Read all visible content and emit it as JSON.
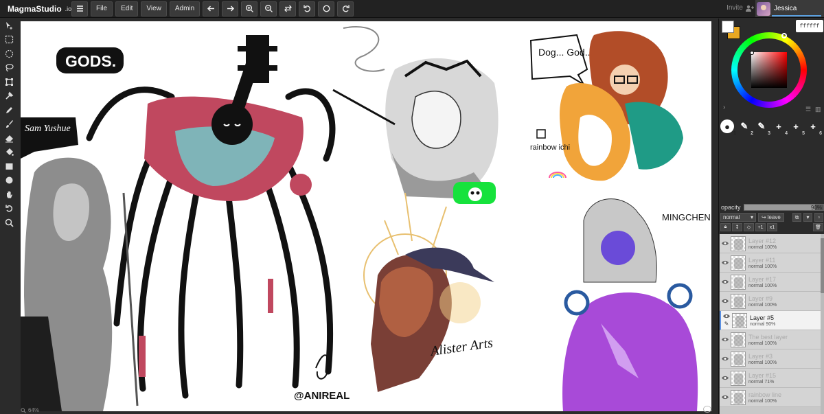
{
  "app": {
    "logo_text": "MagmaStudio",
    "logo_suffix": ".io"
  },
  "menu": {
    "file": "File",
    "edit": "Edit",
    "view": "View",
    "admin": "Admin"
  },
  "toolbar_icons": [
    "hamburger-menu-icon",
    "undo-arrow-icon",
    "redo-arrow-icon",
    "zoom-in-icon",
    "zoom-out-icon",
    "flip-icon",
    "rotate-left-icon",
    "reset-rotation-icon",
    "rotate-right-icon"
  ],
  "header": {
    "invite": "Invite",
    "username": "Jessica"
  },
  "tools": [
    "move",
    "rect-select",
    "lasso-select",
    "transform",
    "crop",
    "eyedropper",
    "brush",
    "pencil",
    "eraser",
    "fill",
    "rectangle",
    "ellipse",
    "hand",
    "rotate",
    "zoom"
  ],
  "canvas": {
    "zoom_label": "64%",
    "artworks": {
      "gods_label": "GODS.",
      "sam_signature": "Sam Yushue",
      "dog_speech": "Dog... God..?",
      "rainbow_label": "rainbow ichi",
      "mingchen_label": "MINGCHEN SHEN",
      "alister_label": "Alister Arts",
      "anireal_label": "@ANIREAL"
    }
  },
  "color": {
    "primary": "#ffffff",
    "secondary": "#e8a822",
    "hex_value": "ffffff"
  },
  "brushes": [
    {
      "num": "1",
      "active": true
    },
    {
      "num": "2",
      "active": false
    },
    {
      "num": "3",
      "active": false
    },
    {
      "num": "4",
      "active": false
    },
    {
      "num": "5",
      "active": false
    },
    {
      "num": "6",
      "active": false
    }
  ],
  "layer_panel": {
    "opacity_label": "opacity",
    "opacity_value": "90%",
    "opacity_fraction": 0.9,
    "blend_mode": "normal",
    "leave_label": "leave",
    "tools": [
      "lock",
      "clip",
      "erase",
      "+1",
      "x1"
    ]
  },
  "layers": [
    {
      "name": "Layer #12",
      "mode": "normal 100%",
      "selected": false
    },
    {
      "name": "Layer #11",
      "mode": "normal 100%",
      "selected": false
    },
    {
      "name": "Layer #17",
      "mode": "normal 100%",
      "selected": false
    },
    {
      "name": "Layer #9",
      "mode": "normal 100%",
      "selected": false
    },
    {
      "name": "Layer #5",
      "mode": "normal 90%",
      "selected": true
    },
    {
      "name": "The best layer",
      "mode": "normal 100%",
      "selected": false
    },
    {
      "name": "Layer #3",
      "mode": "normal 100%",
      "selected": false
    },
    {
      "name": "Layer #15",
      "mode": "normal 71%",
      "selected": false
    },
    {
      "name": "rainbow line",
      "mode": "normal 100%",
      "selected": false
    }
  ]
}
